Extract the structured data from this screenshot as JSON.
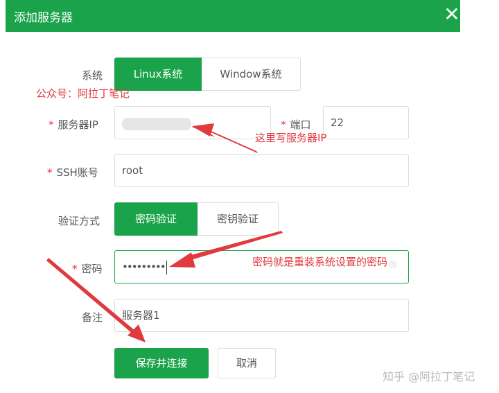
{
  "dialog": {
    "title": "添加服务器",
    "close_icon": "close-icon"
  },
  "form": {
    "system_label": "系统",
    "system_options": [
      "Linux系统",
      "Window系统"
    ],
    "ip_label": "服务器IP",
    "ip_value": "",
    "port_label": "端口",
    "port_value": "22",
    "ssh_label": "SSH账号",
    "ssh_value": "root",
    "auth_label": "验证方式",
    "auth_options": [
      "密码验证",
      "密钥验证"
    ],
    "password_label": "密码",
    "password_value": "•••••••••",
    "note_label": "备注",
    "note_value": "服务器1",
    "required_mark": "*"
  },
  "actions": {
    "save_label": "保存并连接",
    "cancel_label": "取消"
  },
  "annotations": {
    "account": "公众号：阿拉丁笔记",
    "ip_hint": "这里写服务器IP",
    "password_hint": "密码就是重装系统设置的密码"
  },
  "watermark": "知乎 @阿拉丁笔记",
  "colors": {
    "primary": "#1aa34a",
    "annotation": "#e0393e",
    "border": "#dcdcdc"
  }
}
